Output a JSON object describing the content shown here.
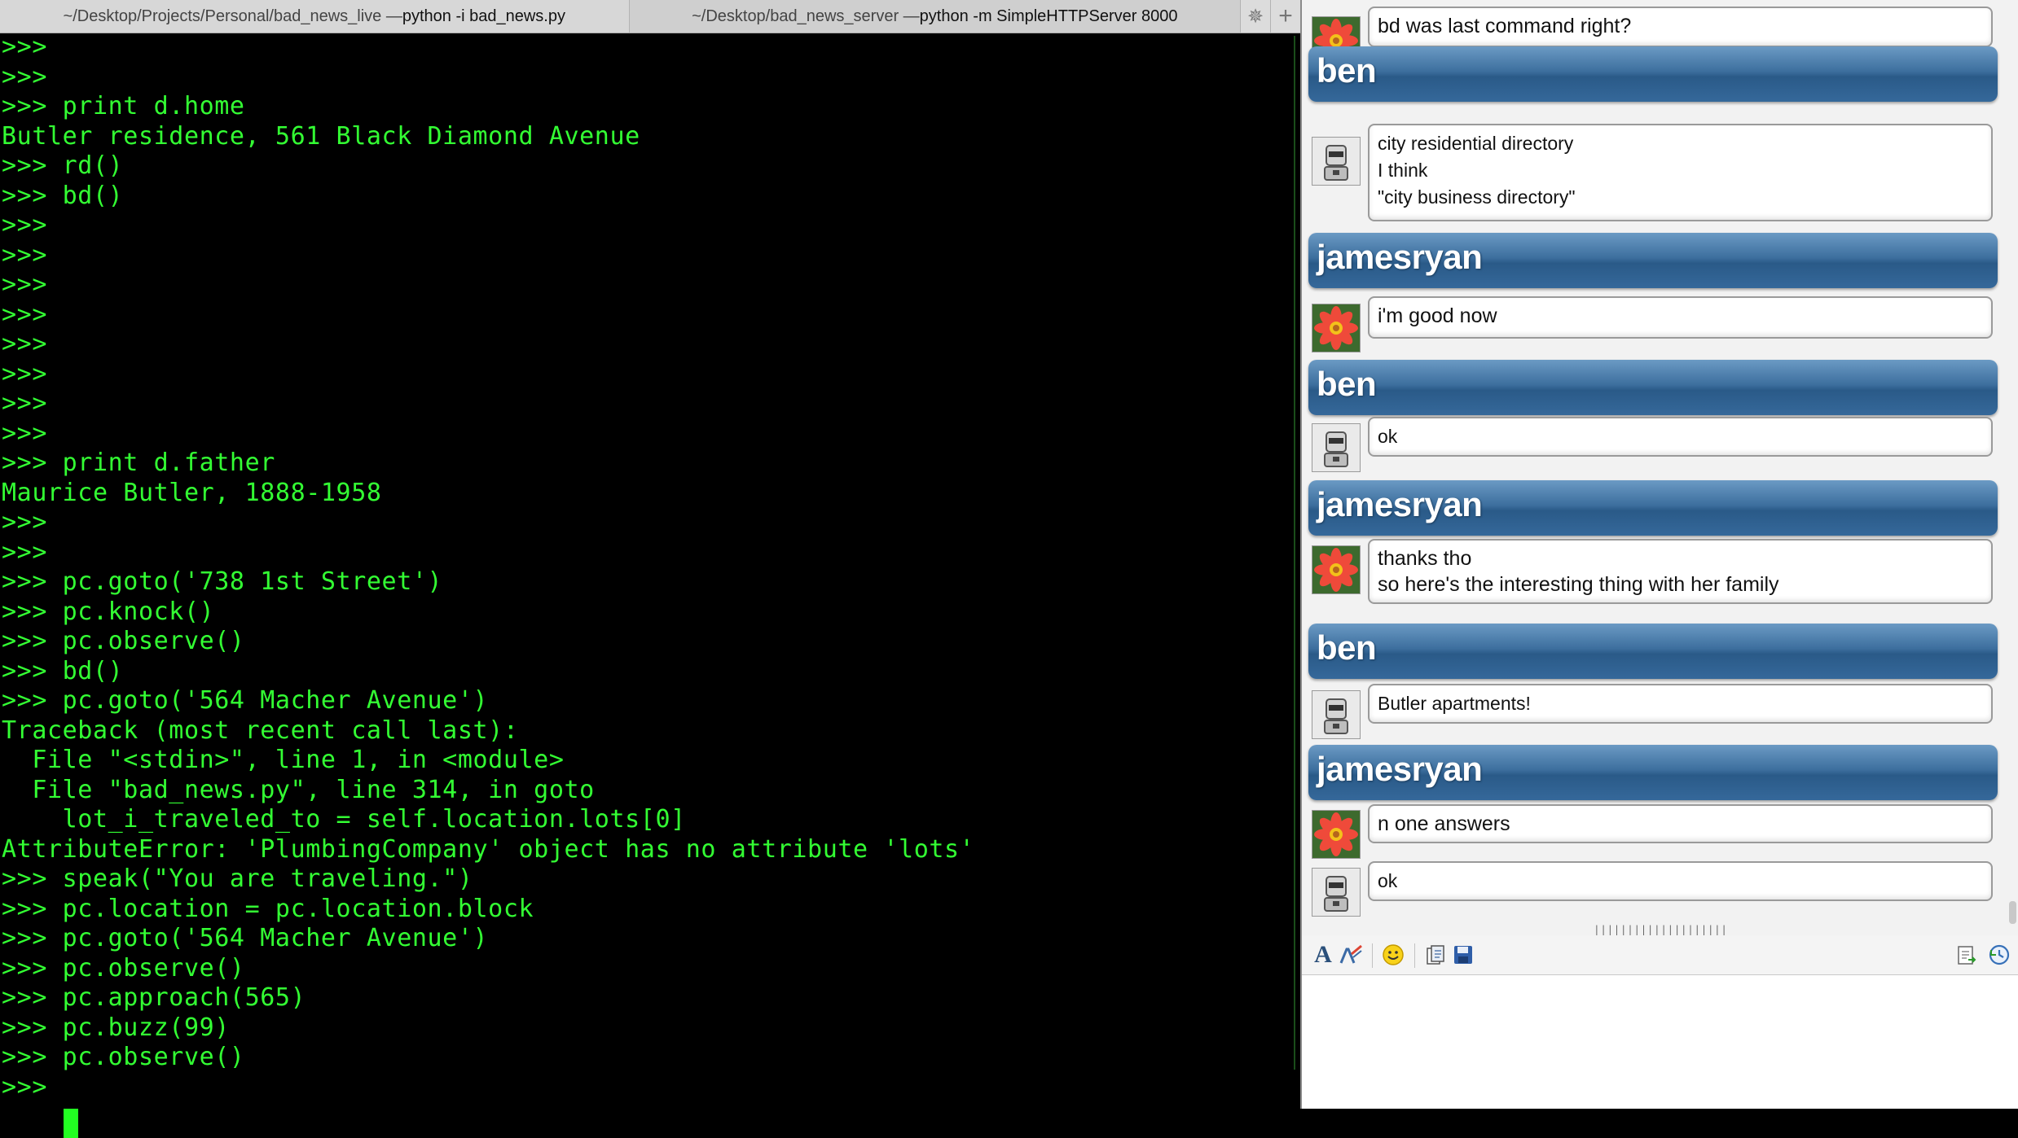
{
  "tabs": [
    {
      "path": "~/Desktop/Projects/Personal/bad_news_live — ",
      "command": "python -i bad_news.py"
    },
    {
      "path": "~/Desktop/bad_news_server — ",
      "command": "python -m SimpleHTTPServer 8000"
    }
  ],
  "terminal": {
    "lines": [
      ">>>",
      ">>>",
      ">>> print d.home",
      "Butler residence, 561 Black Diamond Avenue",
      ">>> rd()",
      ">>> bd()",
      ">>>",
      ">>>",
      ">>>",
      ">>>",
      ">>>",
      ">>>",
      ">>>",
      ">>>",
      ">>> print d.father",
      "Maurice Butler, 1888-1958",
      ">>>",
      ">>>",
      ">>> pc.goto('738 1st Street')",
      ">>> pc.knock()",
      ">>> pc.observe()",
      ">>> bd()",
      ">>> pc.goto('564 Macher Avenue')",
      "Traceback (most recent call last):",
      "  File \"<stdin>\", line 1, in <module>",
      "  File \"bad_news.py\", line 314, in goto",
      "    lot_i_traveled_to = self.location.lots[0]",
      "AttributeError: 'PlumbingCompany' object has no attribute 'lots'",
      ">>> speak(\"You are traveling.\")",
      ">>> pc.location = pc.location.block",
      ">>> pc.goto('564 Macher Avenue')",
      ">>> pc.observe()",
      ">>> pc.approach(565)",
      ">>> pc.buzz(99)",
      ">>> pc.observe()",
      ">>> "
    ]
  },
  "chat": {
    "entries": [
      {
        "kind": "bubble",
        "avatar": "flower-avatar",
        "lines": [
          "bd was last command right?"
        ]
      },
      {
        "kind": "header",
        "name": "ben"
      },
      {
        "kind": "bubble",
        "avatar": "robot-avatar",
        "lines": [
          "city residential directory",
          "I think",
          "\"city business directory\""
        ]
      },
      {
        "kind": "header",
        "name": "jamesryan"
      },
      {
        "kind": "bubble",
        "avatar": "flower-avatar",
        "lines": [
          "i'm good now"
        ]
      },
      {
        "kind": "header",
        "name": "ben"
      },
      {
        "kind": "bubble",
        "avatar": "robot-avatar",
        "lines": [
          "ok"
        ]
      },
      {
        "kind": "header",
        "name": "jamesryan"
      },
      {
        "kind": "bubble",
        "avatar": "flower-avatar",
        "lines": [
          "thanks tho",
          "so here's the interesting thing with her family"
        ]
      },
      {
        "kind": "header",
        "name": "ben"
      },
      {
        "kind": "bubble",
        "avatar": "robot-avatar",
        "lines": [
          "Butler apartments!"
        ]
      },
      {
        "kind": "header",
        "name": "jamesryan"
      },
      {
        "kind": "bubble",
        "avatar": "flower-avatar",
        "lines": [
          "n one answers"
        ]
      },
      {
        "kind": "bubble",
        "avatar": "robot-avatar",
        "lines": [
          "ok"
        ]
      }
    ],
    "toolbar": [
      "font-icon",
      "font-color-icon",
      "smiley-icon",
      "send-file-icon",
      "save-icon",
      "transcript-icon",
      "history-icon"
    ]
  },
  "colors": {
    "terminal_text": "#33ff33",
    "header_blue": "#2f6193"
  }
}
